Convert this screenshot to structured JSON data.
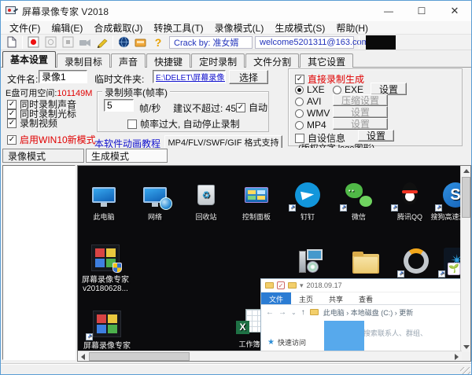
{
  "window": {
    "title": "屏幕录像专家 V2018",
    "minimize": "—",
    "maximize": "☐",
    "close": "✕"
  },
  "menu": {
    "items": [
      "文件(F)",
      "编辑(E)",
      "合成截取(J)",
      "转换工具(T)",
      "录像模式(L)",
      "生成模式(S)",
      "帮助(H)"
    ]
  },
  "toolbar": {
    "crack_text": "Crack by: 准女婿",
    "email": "welcome5201311@163.com",
    "help_glyph": "?"
  },
  "tabs": {
    "items": [
      "基本设置",
      "录制目标",
      "声音",
      "快捷键",
      "定时录制",
      "文件分割",
      "其它设置"
    ]
  },
  "basic": {
    "filename_label": "文件名:",
    "filename_value": "录像1",
    "disk_label": "E盘可用空间:",
    "disk_value": "101149M",
    "cb_sound": "同时录制声音",
    "cb_cursor": "同时录制光标",
    "cb_video": "录制视频",
    "cb_win10": "启用WIN10新模式",
    "temp_label": "临时文件夹:",
    "temp_value": "E:\\DELET\\屏幕录像专家 V",
    "choose_btn": "选择",
    "fr_group": "录制频率(帧率)",
    "fr_value": "5",
    "fr_unit": "帧/秒",
    "fr_hint": "建议不超过: 45",
    "fr_auto": "自动",
    "fr_stop": "帧率过大, 自动停止录制",
    "tutorial_link": "本软件动画教程",
    "format_btn": "MP4/FLV/SWF/GIF  格式支持",
    "direct": {
      "cb_direct": "直接录制生成",
      "r_lxe": "LXE",
      "r_exe": "EXE",
      "btn_set1": "设置",
      "r_avi": "AVI",
      "btn_compress": "压缩设置",
      "r_wmv": "WMV",
      "btn_set2": "设置",
      "r_mp4": "MP4",
      "btn_set3": "设置",
      "cb_custom": "自设信息",
      "btn_set4": "设置",
      "note": "(版权文字 logo图形)"
    }
  },
  "mode_tabs": {
    "record": "录像模式",
    "generate": "生成模式"
  },
  "preview": {
    "icons_row1": [
      {
        "label": "此电脑"
      },
      {
        "label": "网络"
      },
      {
        "label": "回收站"
      },
      {
        "label": "控制面板"
      },
      {
        "label": "钉钉"
      },
      {
        "label": "微信"
      },
      {
        "label": "腾讯QQ"
      },
      {
        "label": "搜狗高速浏览器"
      }
    ],
    "app_icon1_line1": "屏幕录像专家",
    "app_icon1_line2": "v20180628...",
    "app_icon2_label": "屏幕录像专家",
    "excel_label": "工作簿",
    "explorer": {
      "title": "2018.09.17",
      "tab_file": "文件",
      "tab_home": "主页",
      "tab_share": "共享",
      "tab_view": "查看",
      "breadcrumb": "此电脑 › 本地磁盘 (C:) › 更新",
      "search": "搜索联系人、群组、",
      "quick_access": "快速访问"
    }
  },
  "colors": {
    "accent": "#2b7cd3",
    "alert_red": "#e00000",
    "link_blue": "#1111cc"
  }
}
